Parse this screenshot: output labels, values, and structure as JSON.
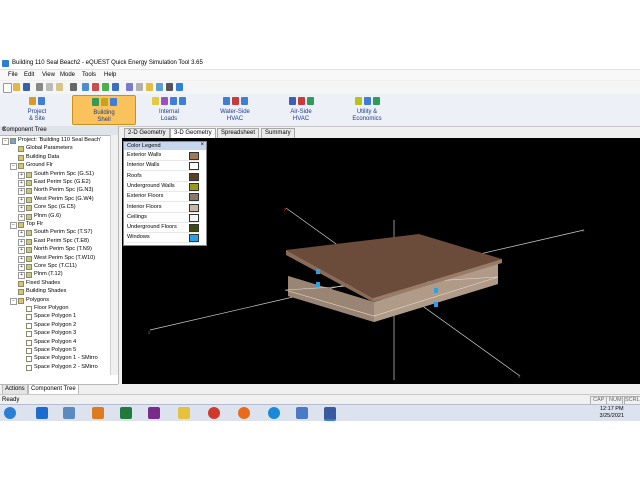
{
  "window": {
    "title": "Building 110 Seal Beach2 - eQUEST Quick Energy Simulation Tool 3.65"
  },
  "menu": [
    "File",
    "Edit",
    "View",
    "Mode",
    "Tools",
    "Help"
  ],
  "ribbon": [
    {
      "label": "Project\n& Site",
      "icons": [
        "#d59a2a",
        "#3e7ed6"
      ]
    },
    {
      "label": "Building\nShell",
      "icons": [
        "#2f9a5a",
        "#c9a21b",
        "#3e7ed6"
      ],
      "active": true
    },
    {
      "label": "Internal\nLoads",
      "icons": [
        "#e4c93b",
        "#9c4fc2",
        "#3e7ed6",
        "#3e7ed6"
      ]
    },
    {
      "label": "Water-Side\nHVAC",
      "icons": [
        "#3e7ed6",
        "#c73b3b",
        "#3e7ed6"
      ]
    },
    {
      "label": "Air-Side\nHVAC",
      "icons": [
        "#3e5fb6",
        "#c73b3b",
        "#2f9a5a"
      ]
    },
    {
      "label": "Utility &\nEconomics",
      "icons": [
        "#b9c21b",
        "#3e7ed6",
        "#2f9a5a"
      ]
    }
  ],
  "component_tree": {
    "header": "Component Tree",
    "items": [
      {
        "indent": 0,
        "exp": "−",
        "label": "Project: 'Building 110 Seal Beach'",
        "icon": "#7aa0d8"
      },
      {
        "indent": 1,
        "exp": "",
        "label": "Global Parameters",
        "icon": "#d9c46a"
      },
      {
        "indent": 1,
        "exp": "",
        "label": "Building Data",
        "icon": "#d9c46a"
      },
      {
        "indent": 1,
        "exp": "−",
        "label": "Ground Flr",
        "icon": "#d9c46a"
      },
      {
        "indent": 2,
        "exp": "+",
        "label": "South Perim Spc (G.S1)",
        "icon": "#c7c78a"
      },
      {
        "indent": 2,
        "exp": "+",
        "label": "East Perim Spc (G.E2)",
        "icon": "#c7c78a"
      },
      {
        "indent": 2,
        "exp": "+",
        "label": "North Perim Spc (G.N3)",
        "icon": "#c7c78a"
      },
      {
        "indent": 2,
        "exp": "+",
        "label": "West Perim Spc (G.W4)",
        "icon": "#c7c78a"
      },
      {
        "indent": 2,
        "exp": "+",
        "label": "Core Spc (G.C5)",
        "icon": "#c7c78a"
      },
      {
        "indent": 2,
        "exp": "+",
        "label": "Plnm (G.6)",
        "icon": "#c7c78a"
      },
      {
        "indent": 1,
        "exp": "−",
        "label": "Top Flr",
        "icon": "#d9c46a"
      },
      {
        "indent": 2,
        "exp": "+",
        "label": "South Perim Spc (T.S7)",
        "icon": "#c7c78a"
      },
      {
        "indent": 2,
        "exp": "+",
        "label": "East Perim Spc (T.E8)",
        "icon": "#c7c78a"
      },
      {
        "indent": 2,
        "exp": "+",
        "label": "North Perim Spc (T.N9)",
        "icon": "#c7c78a"
      },
      {
        "indent": 2,
        "exp": "+",
        "label": "West Perim Spc (T.W10)",
        "icon": "#c7c78a"
      },
      {
        "indent": 2,
        "exp": "+",
        "label": "Core Spc (T.C11)",
        "icon": "#c7c78a"
      },
      {
        "indent": 2,
        "exp": "+",
        "label": "Plnm (T.12)",
        "icon": "#c7c78a"
      },
      {
        "indent": 1,
        "exp": "",
        "label": "Fixed Shades",
        "icon": "#d9c46a"
      },
      {
        "indent": 1,
        "exp": "",
        "label": "Building Shades",
        "icon": "#d9c46a"
      },
      {
        "indent": 1,
        "exp": "−",
        "label": "Polygons",
        "icon": "#d9c46a"
      },
      {
        "indent": 2,
        "exp": "",
        "label": "Floor Polygon",
        "icon": "#ffffff"
      },
      {
        "indent": 2,
        "exp": "",
        "label": "Space Polygon 1",
        "icon": "#ffffff"
      },
      {
        "indent": 2,
        "exp": "",
        "label": "Space Polygon 2",
        "icon": "#ffffff"
      },
      {
        "indent": 2,
        "exp": "",
        "label": "Space Polygon 3",
        "icon": "#ffffff"
      },
      {
        "indent": 2,
        "exp": "",
        "label": "Space Polygon 4",
        "icon": "#ffffff"
      },
      {
        "indent": 2,
        "exp": "",
        "label": "Space Polygon 5",
        "icon": "#ffffff"
      },
      {
        "indent": 2,
        "exp": "",
        "label": "Space Polygon 1 - SMirro",
        "icon": "#ffffff"
      },
      {
        "indent": 2,
        "exp": "",
        "label": "Space Polygon 2 - SMirro",
        "icon": "#ffffff"
      }
    ]
  },
  "bottom_tabs": [
    "Actions",
    "Component Tree"
  ],
  "view_tabs": [
    "2-D Geometry",
    "3-D Geometry",
    "Spreadsheet",
    "Summary"
  ],
  "legend": {
    "title": "Color Legend",
    "items": [
      {
        "label": "Exterior Walls",
        "color": "#a07858"
      },
      {
        "label": "Interior Walls",
        "color": "#ffffff"
      },
      {
        "label": "Roofs",
        "color": "#5a3d2a"
      },
      {
        "label": "Underground Walls",
        "color": "#9a9a1a"
      },
      {
        "label": "Exterior Floors",
        "color": "#8a7868"
      },
      {
        "label": "Interior Floors",
        "color": "#c8b8a8"
      },
      {
        "label": "Ceilings",
        "color": "#f4f4f4"
      },
      {
        "label": "Underground Floors",
        "color": "#3a4a10"
      },
      {
        "label": "Windows",
        "color": "#2aa0e8"
      }
    ]
  },
  "status": {
    "text": "Ready",
    "indicators": [
      "CAP",
      "NUM",
      "SCRL"
    ]
  },
  "taskbar": {
    "time": "12:17 PM",
    "date": "3/25/2021"
  }
}
